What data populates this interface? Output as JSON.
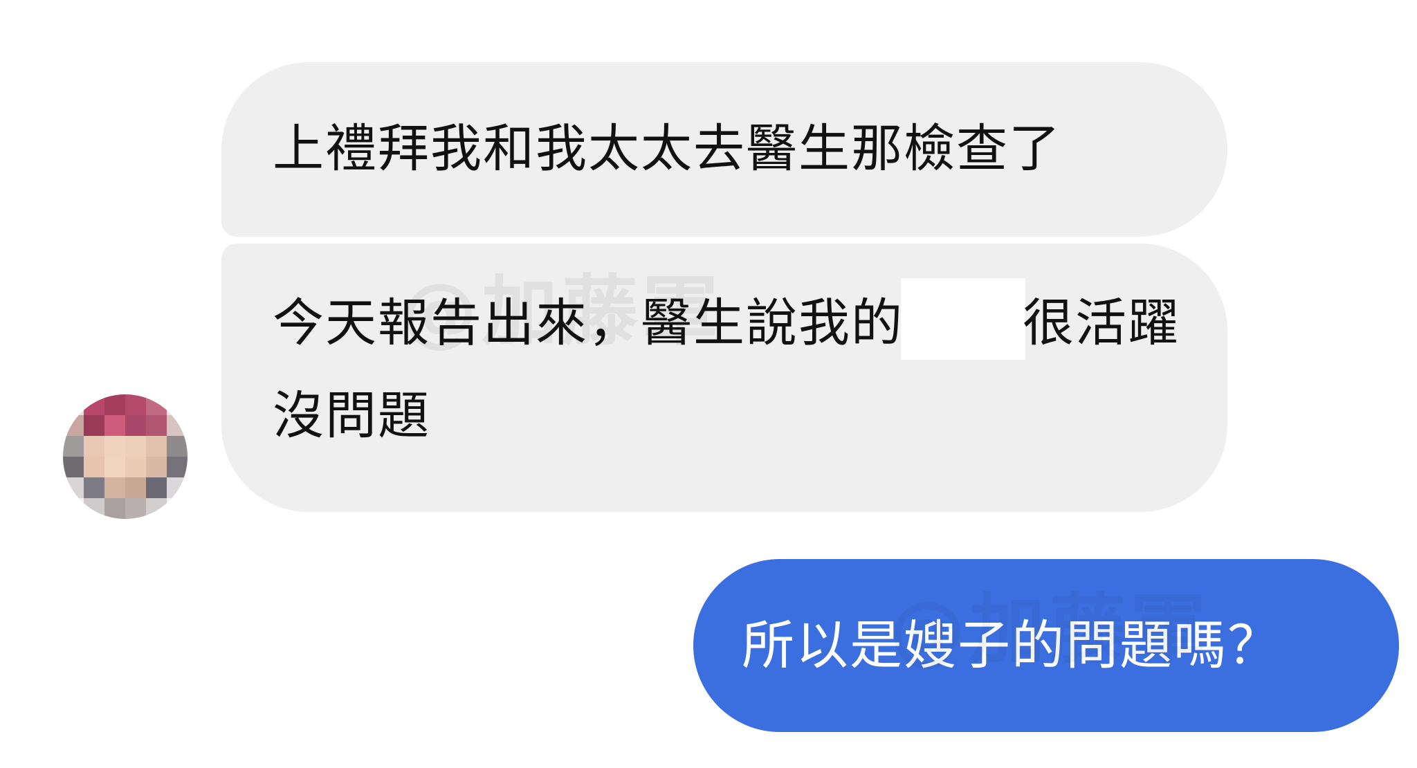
{
  "chat": {
    "messages": [
      {
        "sender": "contact",
        "text": "上禮拜我和我太太去醫生那檢查了"
      },
      {
        "sender": "contact",
        "text_before": "今天報告出來，醫生說我的",
        "text_after": "很活躍沒問題"
      },
      {
        "sender": "me",
        "text": "所以是嫂子的問題嗎？"
      }
    ],
    "watermark": "@加藤軍"
  },
  "colors": {
    "received_bubble": "#efefef",
    "sent_bubble": "#3b6fe0",
    "background": "#ffffff"
  }
}
